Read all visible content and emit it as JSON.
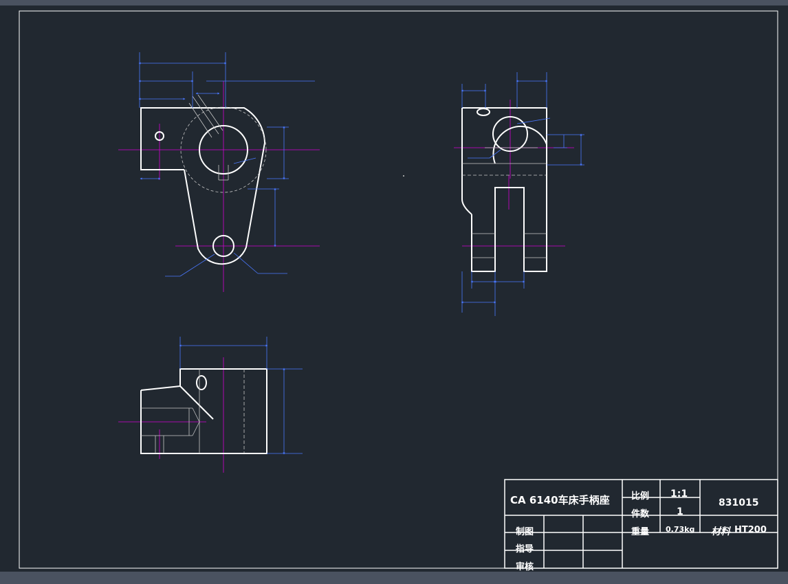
{
  "title_block": {
    "part_name": "CA 6140车床手柄座",
    "scale_label": "比例",
    "scale_value": "1:1",
    "quantity_label": "件数",
    "quantity_value": "1",
    "drawing_number": "831015",
    "weight_label": "重量",
    "weight_value": "0.73kg",
    "material_label": "材料",
    "material_value": "HT200",
    "drawn_label": "制图",
    "guided_label": "指导",
    "reviewed_label": "审核"
  },
  "colors": {
    "background": "#212830",
    "outline": "#ffffff",
    "centerline": "#d400d4",
    "dimension": "#4a78ff",
    "hatch": "#c8c8c8"
  }
}
